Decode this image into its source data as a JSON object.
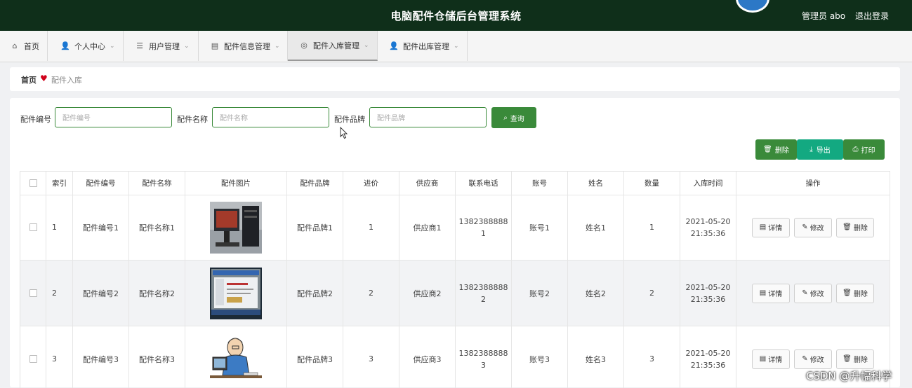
{
  "header": {
    "title": "电脑配件仓储后台管理系统",
    "user_label": "管理员 abo",
    "logout_label": "退出登录"
  },
  "nav": {
    "items": [
      {
        "label": "首页",
        "icon": "home-icon"
      },
      {
        "label": "个人中心",
        "icon": "person-icon"
      },
      {
        "label": "用户管理",
        "icon": "list-icon"
      },
      {
        "label": "配件信息管理",
        "icon": "box-icon"
      },
      {
        "label": "配件入库管理",
        "icon": "circle-icon"
      },
      {
        "label": "配件出库管理",
        "icon": "person-icon"
      }
    ]
  },
  "breadcrumb": {
    "home": "首页",
    "current": "配件入库"
  },
  "search": {
    "code_label": "配件编号",
    "code_placeholder": "配件编号",
    "name_label": "配件名称",
    "name_placeholder": "配件名称",
    "brand_label": "配件品牌",
    "brand_placeholder": "配件品牌",
    "query_label": "查询"
  },
  "toolbar": {
    "delete_label": "删除",
    "export_label": "导出",
    "print_label": "打印"
  },
  "table": {
    "columns": [
      "索引",
      "配件编号",
      "配件名称",
      "配件图片",
      "配件品牌",
      "进价",
      "供应商",
      "联系电话",
      "账号",
      "姓名",
      "数量",
      "入库时间",
      "操作"
    ],
    "rows": [
      {
        "index": "1",
        "code": "配件编号1",
        "name": "配件名称1",
        "brand": "配件品牌1",
        "price": "1",
        "supplier": "供应商1",
        "phone_a": "1382388888",
        "phone_b": "1",
        "account": "账号1",
        "person": "姓名1",
        "qty": "1",
        "date": "2021-05-20",
        "time": "21:35:36",
        "image": "computer-tower-photo"
      },
      {
        "index": "2",
        "code": "配件编号2",
        "name": "配件名称2",
        "brand": "配件品牌2",
        "price": "2",
        "supplier": "供应商2",
        "phone_a": "1382388888",
        "phone_b": "2",
        "account": "账号2",
        "person": "姓名2",
        "qty": "2",
        "date": "2021-05-20",
        "time": "21:35:36",
        "image": "screen-window-photo"
      },
      {
        "index": "3",
        "code": "配件编号3",
        "name": "配件名称3",
        "brand": "配件品牌3",
        "price": "3",
        "supplier": "供应商3",
        "phone_a": "1382388888",
        "phone_b": "3",
        "account": "账号3",
        "person": "姓名3",
        "qty": "3",
        "date": "2021-05-20",
        "time": "21:35:36",
        "image": "man-at-computer-cartoon"
      }
    ],
    "actions": {
      "detail": "详情",
      "edit": "修改",
      "delete": "删除"
    }
  },
  "watermark": "CSDN @升幅科学",
  "colors": {
    "topbar": "#0f2f1a",
    "primary_green": "#3a8a3a",
    "teal": "#13a981"
  }
}
